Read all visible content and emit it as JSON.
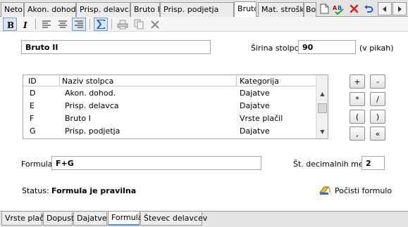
{
  "top_tabs": [
    {
      "label": "Neto"
    },
    {
      "label": "Akon. dohod."
    },
    {
      "label": "Prisp. delavca"
    },
    {
      "label": "Bruto I"
    },
    {
      "label": "Prisp. podjetja"
    },
    {
      "label": "Bruto II"
    },
    {
      "label": "Mat. stroški"
    },
    {
      "label": "Bo"
    }
  ],
  "active_tab": "Bruto II",
  "column_name": "Bruto II",
  "column_width": {
    "label": "Širina stolpca",
    "value": "90",
    "unit": "(v pikah)"
  },
  "list": {
    "headers": {
      "id": "ID",
      "name": "Naziv stolpca",
      "category": "Kategorija"
    },
    "rows": [
      {
        "id": "D",
        "name": "Akon. dohod.",
        "category": "Dajatve"
      },
      {
        "id": "E",
        "name": "Prisp. delavca",
        "category": "Dajatve"
      },
      {
        "id": "F",
        "name": "Bruto I",
        "category": "Vrste plačil"
      },
      {
        "id": "G",
        "name": "Prisp. podjetja",
        "category": "Dajatve"
      }
    ]
  },
  "operators": [
    "+",
    "-",
    "*",
    "/",
    "(",
    ")",
    ",",
    "«"
  ],
  "formula": {
    "label": "Formula",
    "value": "F+G"
  },
  "decimals": {
    "label": "Št. decimalnih mest",
    "value": "2"
  },
  "status": {
    "label": "Status:",
    "value": "Formula je pravilna"
  },
  "clear_formula_label": "Počisti formulo",
  "bottom_tabs": [
    {
      "label": "Vrste plačil"
    },
    {
      "label": "Dopust"
    },
    {
      "label": "Dajatve"
    },
    {
      "label": "Formula"
    },
    {
      "label": "Števec delavcev"
    }
  ],
  "active_bottom_tab": "Formula",
  "colors": {
    "accent": "#4d8fd6",
    "delete_red": "#d42020",
    "sigma_blue": "#1f5fbf"
  }
}
